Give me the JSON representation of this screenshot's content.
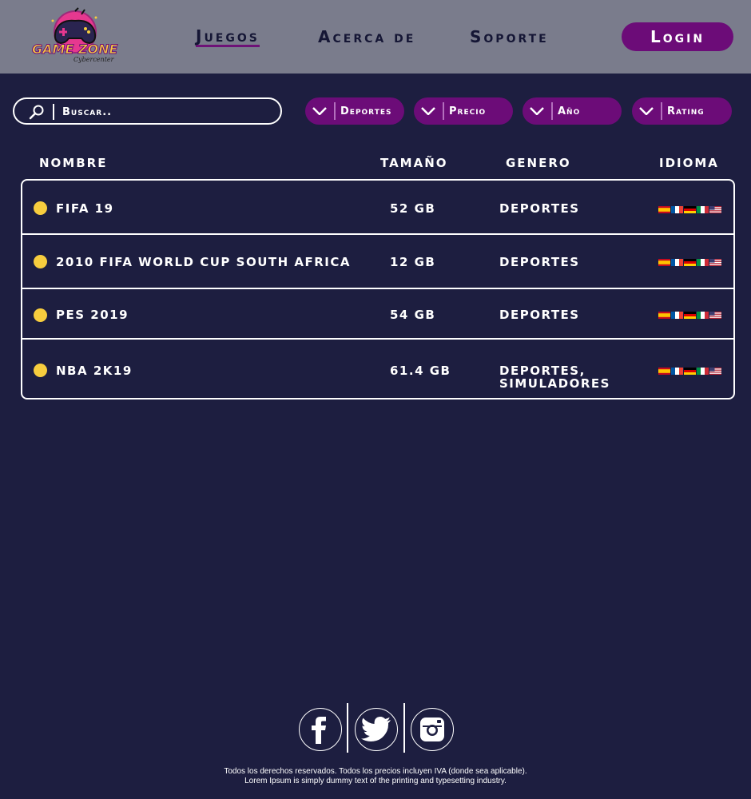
{
  "brand": {
    "name": "GAME ZONE",
    "tagline": "Cybercenter"
  },
  "nav": {
    "links": [
      {
        "label": "Juegos",
        "active": true
      },
      {
        "label": "Acerca de",
        "active": false
      },
      {
        "label": "Soporte",
        "active": false
      }
    ],
    "login_label": "Login"
  },
  "search": {
    "placeholder": "Buscar.."
  },
  "filters": [
    {
      "label": "Deportes"
    },
    {
      "label": "Precio"
    },
    {
      "label": "Año"
    },
    {
      "label": "Rating"
    }
  ],
  "table": {
    "headers": {
      "name": "NOMBRE",
      "size": "TAMAÑO",
      "genre": "GENERO",
      "language": "IDIOMA"
    },
    "rows": [
      {
        "name": "FIFA 19",
        "size": "52 GB",
        "genre": "DEPORTES",
        "genre2": "",
        "languages": [
          "es",
          "fr",
          "de",
          "it",
          "us"
        ]
      },
      {
        "name": "2010 FIFA WORLD CUP SOUTH AFRICA",
        "size": "12 GB",
        "genre": "DEPORTES",
        "genre2": "",
        "languages": [
          "es",
          "fr",
          "de",
          "it",
          "us"
        ]
      },
      {
        "name": "PES 2019",
        "size": "54 GB",
        "genre": "DEPORTES",
        "genre2": "",
        "languages": [
          "es",
          "fr",
          "de",
          "it",
          "us"
        ]
      },
      {
        "name": "NBA 2K19",
        "size": "61.4 GB",
        "genre": "DEPORTES,",
        "genre2": "SIMULADORES",
        "languages": [
          "es",
          "fr",
          "de",
          "it",
          "us"
        ]
      }
    ]
  },
  "footer": {
    "social": [
      "facebook-icon",
      "twitter-icon",
      "instagram-icon"
    ],
    "line1": "Todos los derechos reservados. Todos los precios incluyen IVA (donde sea aplicable).",
    "line2": "Lorem Ipsum is simply dummy text of the printing and typesetting industry."
  },
  "colors": {
    "background": "#1d1e40",
    "header": "#7a7c8c",
    "accent": "#6c0c78",
    "status_dot": "#f7cd3e"
  }
}
